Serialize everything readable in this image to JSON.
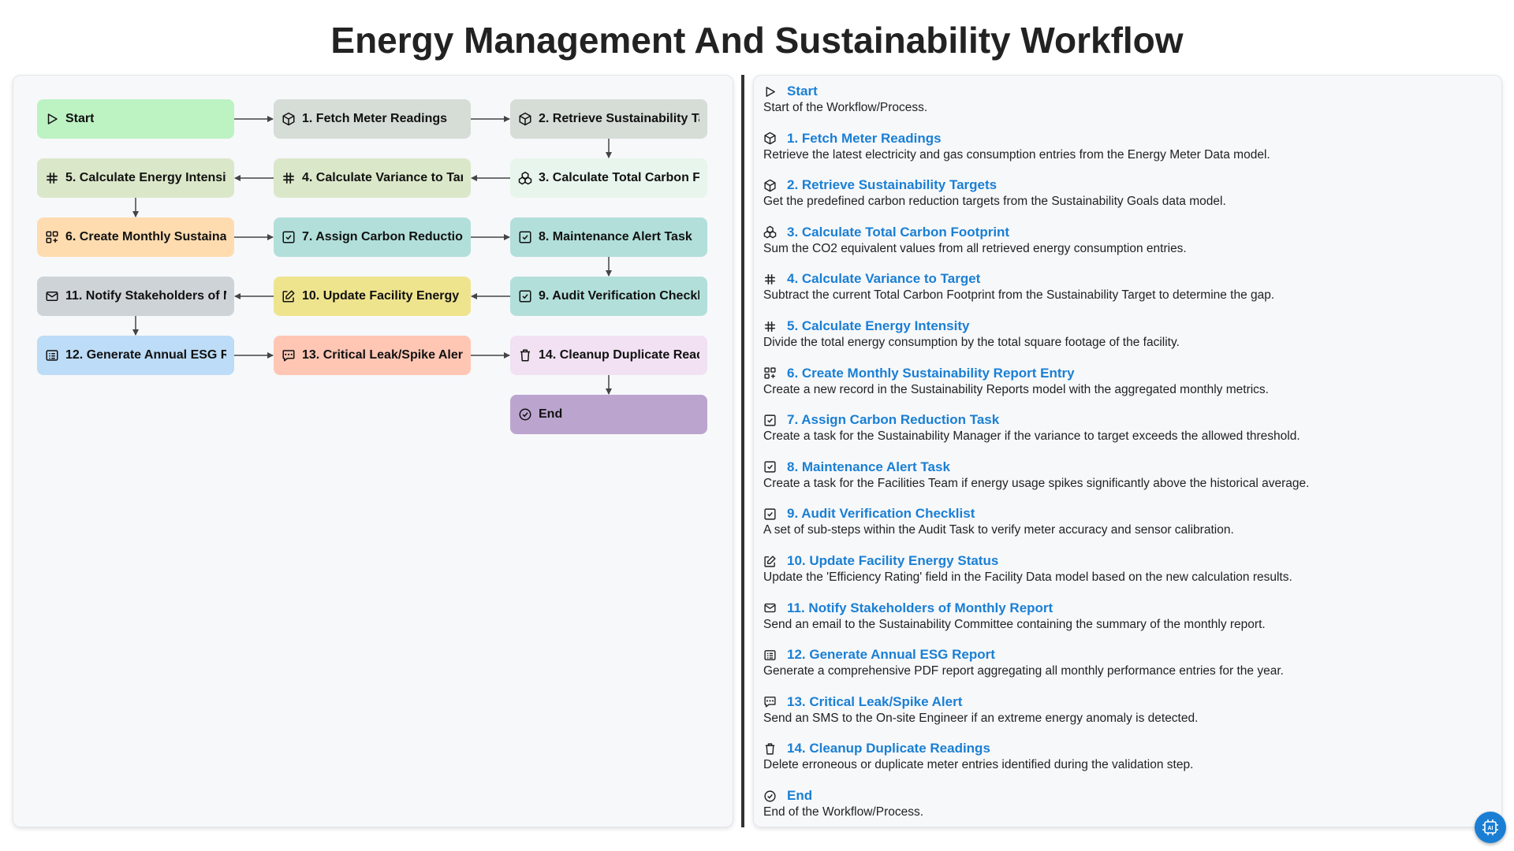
{
  "title": "Energy Management And Sustainability Workflow",
  "colors": {
    "link": "#1a7fd4",
    "start": "#bdf2c3",
    "gray_green": "#d5ddd6",
    "light_green": "#e8f5ec",
    "olive_light": "#dbe7c9",
    "orange": "#ffdcb0",
    "teal": "#b2dfda",
    "slate": "#ced3d8",
    "yellow": "#efe48e",
    "blue": "#bcdcf7",
    "salmon": "#ffc6b4",
    "lavender": "#f1e1f2",
    "purple": "#bba5cf"
  },
  "nodes": [
    {
      "id": "start",
      "label": "Start",
      "icon": "play-icon",
      "color": "#bdf2c3"
    },
    {
      "id": "n1",
      "label": "1. Fetch Meter Readings",
      "icon": "cube-icon",
      "color": "#d5ddd6"
    },
    {
      "id": "n2",
      "label": "2. Retrieve Sustainability Targets",
      "icon": "cube-icon",
      "color": "#d5ddd6"
    },
    {
      "id": "n3",
      "label": "3. Calculate Total Carbon Footprint",
      "icon": "cubes-icon",
      "color": "#e8f5ec"
    },
    {
      "id": "n4",
      "label": "4. Calculate Variance to Target",
      "icon": "hash-icon",
      "color": "#dbe7c9"
    },
    {
      "id": "n5",
      "label": "5. Calculate Energy Intensity",
      "icon": "hash-icon",
      "color": "#dbe7c9"
    },
    {
      "id": "n6",
      "label": "6. Create Monthly Sustainability Report Entry",
      "icon": "grid-plus-icon",
      "color": "#ffdcb0"
    },
    {
      "id": "n7",
      "label": "7. Assign Carbon Reduction Task",
      "icon": "checkbox-icon",
      "color": "#b2dfda"
    },
    {
      "id": "n8",
      "label": "8. Maintenance Alert Task",
      "icon": "checkbox-icon",
      "color": "#b2dfda"
    },
    {
      "id": "n9",
      "label": "9. Audit Verification Checklist",
      "icon": "checkbox-icon",
      "color": "#b2dfda"
    },
    {
      "id": "n10",
      "label": "10. Update Facility Energy Status",
      "icon": "edit-icon",
      "color": "#efe48e"
    },
    {
      "id": "n11",
      "label": "11. Notify Stakeholders of Monthly Report",
      "icon": "mail-icon",
      "color": "#ced3d8"
    },
    {
      "id": "n12",
      "label": "12. Generate Annual ESG Report",
      "icon": "report-icon",
      "color": "#bcdcf7"
    },
    {
      "id": "n13",
      "label": "13. Critical Leak/Spike Alert",
      "icon": "sms-icon",
      "color": "#ffc6b4"
    },
    {
      "id": "n14",
      "label": "14. Cleanup Duplicate Readings",
      "icon": "trash-icon",
      "color": "#f1e1f2"
    },
    {
      "id": "end",
      "label": "End",
      "icon": "check-circle-icon",
      "color": "#bba5cf"
    }
  ],
  "steps": [
    {
      "title": "Start",
      "icon": "play-icon",
      "desc": "Start of the Workflow/Process."
    },
    {
      "title": "1. Fetch Meter Readings",
      "icon": "cube-icon",
      "desc": "Retrieve the latest electricity and gas consumption entries from the Energy Meter Data model."
    },
    {
      "title": "2. Retrieve Sustainability Targets",
      "icon": "cube-icon",
      "desc": "Get the predefined carbon reduction targets from the Sustainability Goals data model."
    },
    {
      "title": "3. Calculate Total Carbon Footprint",
      "icon": "cubes-icon",
      "desc": "Sum the CO2 equivalent values from all retrieved energy consumption entries."
    },
    {
      "title": "4. Calculate Variance to Target",
      "icon": "hash-icon",
      "desc": "Subtract the current Total Carbon Footprint from the Sustainability Target to determine the gap."
    },
    {
      "title": "5. Calculate Energy Intensity",
      "icon": "hash-icon",
      "desc": "Divide the total energy consumption by the total square footage of the facility."
    },
    {
      "title": "6. Create Monthly Sustainability Report Entry",
      "icon": "grid-plus-icon",
      "desc": "Create a new record in the Sustainability Reports model with the aggregated monthly metrics."
    },
    {
      "title": "7. Assign Carbon Reduction Task",
      "icon": "checkbox-icon",
      "desc": "Create a task for the Sustainability Manager if the variance to target exceeds the allowed threshold."
    },
    {
      "title": "8. Maintenance Alert Task",
      "icon": "checkbox-icon",
      "desc": "Create a task for the Facilities Team if energy usage spikes significantly above the historical average."
    },
    {
      "title": "9. Audit Verification Checklist",
      "icon": "checkbox-icon",
      "desc": "A set of sub-steps within the Audit Task to verify meter accuracy and sensor calibration."
    },
    {
      "title": "10. Update Facility Energy Status",
      "icon": "edit-icon",
      "desc": "Update the 'Efficiency Rating' field in the Facility Data model based on the new calculation results."
    },
    {
      "title": "11. Notify Stakeholders of Monthly Report",
      "icon": "mail-icon",
      "desc": "Send an email to the Sustainability Committee containing the summary of the monthly report."
    },
    {
      "title": "12. Generate Annual ESG Report",
      "icon": "report-icon",
      "desc": "Generate a comprehensive PDF report aggregating all monthly performance entries for the year."
    },
    {
      "title": "13. Critical Leak/Spike Alert",
      "icon": "sms-icon",
      "desc": "Send an SMS to the On-site Engineer if an extreme energy anomaly is detected."
    },
    {
      "title": "14. Cleanup Duplicate Readings",
      "icon": "trash-icon",
      "desc": "Delete erroneous or duplicate meter entries identified during the validation step."
    },
    {
      "title": "End",
      "icon": "check-circle-icon",
      "desc": "End of the Workflow/Process."
    }
  ],
  "edges": [
    [
      "start",
      "n1"
    ],
    [
      "n1",
      "n2"
    ],
    [
      "n2",
      "n3"
    ],
    [
      "n3",
      "n4"
    ],
    [
      "n4",
      "n5"
    ],
    [
      "n5",
      "n6"
    ],
    [
      "n6",
      "n7"
    ],
    [
      "n7",
      "n8"
    ],
    [
      "n8",
      "n9"
    ],
    [
      "n9",
      "n10"
    ],
    [
      "n10",
      "n11"
    ],
    [
      "n11",
      "n12"
    ],
    [
      "n12",
      "n13"
    ],
    [
      "n13",
      "n14"
    ],
    [
      "n14",
      "end"
    ]
  ],
  "fab_icon": "ai-chip-icon"
}
